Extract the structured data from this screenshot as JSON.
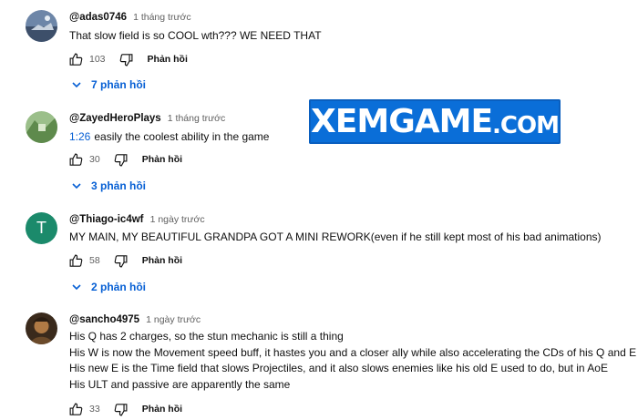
{
  "comments": [
    {
      "author": "@adas0746",
      "time": "1 tháng trước",
      "text": "That slow field is so COOL wth??? WE NEED THAT",
      "likes": "103",
      "reply_label": "Phản hồi",
      "replies_label": "7 phản hồi"
    },
    {
      "author": "@ZayedHeroPlays",
      "time": "1 tháng trước",
      "timestamp": "1:26",
      "text": "easily the coolest ability in the game",
      "likes": "30",
      "reply_label": "Phản hồi",
      "replies_label": "3 phản hồi"
    },
    {
      "author": "@Thiago-ic4wf",
      "avatar_letter": "T",
      "time": "1 ngày trước",
      "text": "MY MAIN, MY BEAUTIFUL GRANDPA GOT A MINI REWORK(even if he still kept most of his bad animations)",
      "likes": "58",
      "reply_label": "Phản hồi",
      "replies_label": "2 phản hồi"
    },
    {
      "author": "@sancho4975",
      "time": "1 ngày trước",
      "lines": [
        "His Q has 2 charges, so the stun mechanic is still a thing",
        "His W is now the Movement speed buff, it hastes you and a closer ally while also accelerating the CDs of his Q and E",
        "His new E is the Time field that slows Projectiles, and it also slows enemies like his old E used to do, but in AoE",
        "His ULT and passive are apparently the same"
      ],
      "likes": "33",
      "reply_label": "Phản hồi"
    }
  ],
  "watermark": {
    "main": "XEMGAME",
    "suffix": ".COM"
  },
  "colors": {
    "link_blue": "#065fd4",
    "logo_blue": "#0a6ed8",
    "avatar_t": "#1b8a6b"
  }
}
